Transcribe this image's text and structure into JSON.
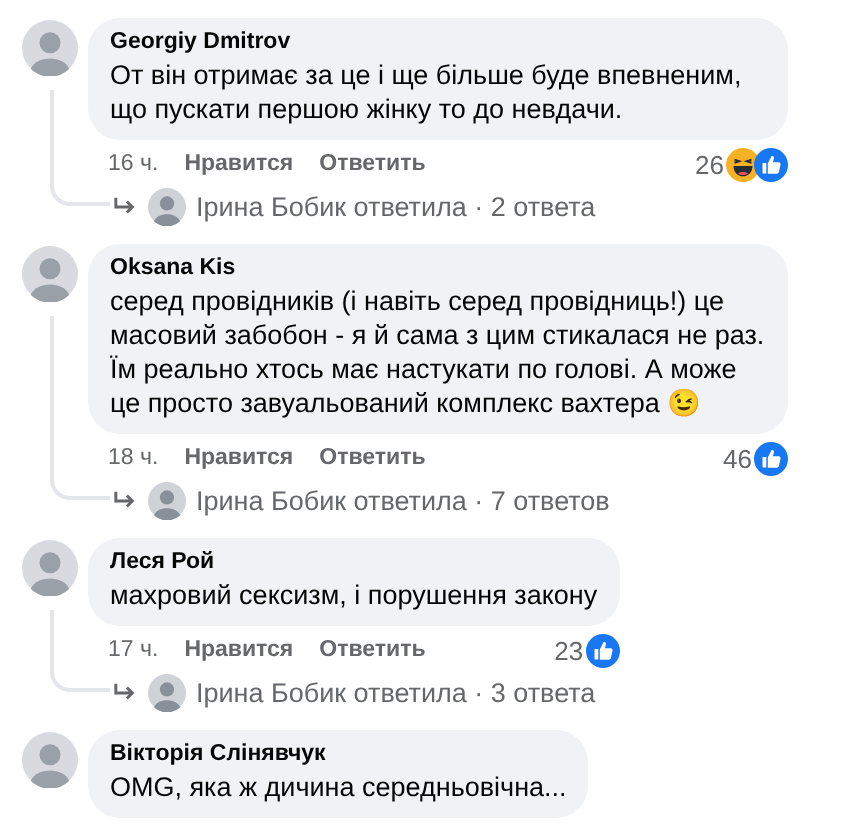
{
  "comments": [
    {
      "author": "Georgiy Dmitrov",
      "text": "От він отримає за це і ще більше буде впевненим, що пускати першою жінку то до невдачи.",
      "time": "16 ч.",
      "like": "Нравится",
      "reply": "Ответить",
      "count": "26",
      "reactions": [
        {
          "kind": "haha"
        },
        {
          "kind": "like"
        }
      ],
      "replies": "Ірина Бобик ответила · 2 ответа"
    },
    {
      "author": "Oksana Kis",
      "text": "серед провідників (і навіть серед провідниць!) це масовий забобон - я й сама з цим стикалася не раз. Їм реально хтось має настукати по голові. А може це просто завуальований комплекс вахтера 😉",
      "time": "18 ч.",
      "like": "Нравится",
      "reply": "Ответить",
      "count": "46",
      "reactions": [
        {
          "kind": "like"
        }
      ],
      "replies": "Ірина Бобик ответила · 7 ответов"
    },
    {
      "author": "Леся Рой",
      "text": "махровий сексизм, і порушення закону",
      "time": "17 ч.",
      "like": "Нравится",
      "reply": "Ответить",
      "count": "23",
      "reactions": [
        {
          "kind": "like"
        }
      ],
      "replies": "Ірина Бобик ответила · 3 ответа"
    },
    {
      "author": "Вікторія Слінявчук",
      "text": "OMG, яка ж дичина середньовічна..."
    }
  ]
}
